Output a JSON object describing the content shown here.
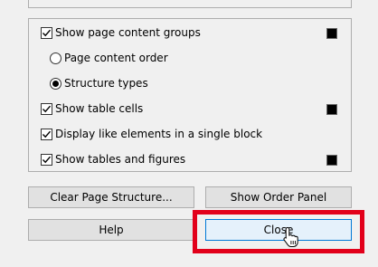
{
  "options": [
    {
      "kind": "checkbox",
      "label": "Show page content groups",
      "checked": true,
      "swatch": true
    },
    {
      "kind": "radio",
      "label": "Page content order",
      "checked": false,
      "swatch": false
    },
    {
      "kind": "radio",
      "label": "Structure types",
      "checked": true,
      "swatch": false
    },
    {
      "kind": "checkbox",
      "label": "Show table cells",
      "checked": true,
      "swatch": true
    },
    {
      "kind": "checkbox",
      "label": "Display like elements in a single block",
      "checked": true,
      "swatch": false
    },
    {
      "kind": "checkbox",
      "label": "Show tables and figures",
      "checked": true,
      "swatch": true
    }
  ],
  "swatch_color": "#000000",
  "buttons": {
    "clear_page_structure": "Clear Page Structure...",
    "show_order_panel": "Show Order Panel",
    "help": "Help",
    "close": "Close"
  },
  "colors": {
    "highlight": "#e2001a",
    "focus_border": "#0078d7"
  }
}
